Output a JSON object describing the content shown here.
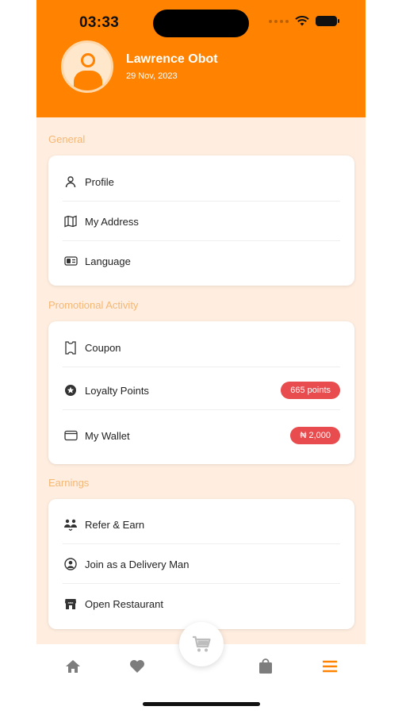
{
  "status": {
    "time": "03:33"
  },
  "profile": {
    "name": "Lawrence Obot",
    "date": "29 Nov, 2023"
  },
  "sections": {
    "general": {
      "title": "General",
      "items": [
        {
          "label": "Profile",
          "icon": "person-icon"
        },
        {
          "label": "My Address",
          "icon": "map-icon"
        },
        {
          "label": "Language",
          "icon": "language-icon"
        }
      ]
    },
    "promotional": {
      "title": "Promotional Activity",
      "items": [
        {
          "label": "Coupon",
          "icon": "coupon-icon"
        },
        {
          "label": "Loyalty Points",
          "icon": "star-badge-icon",
          "badge": "665 points"
        },
        {
          "label": "My Wallet",
          "icon": "wallet-icon",
          "badge": "₦ 2,000"
        }
      ]
    },
    "earnings": {
      "title": "Earnings",
      "items": [
        {
          "label": "Refer & Earn",
          "icon": "people-icon"
        },
        {
          "label": "Join as a Delivery Man",
          "icon": "delivery-man-icon"
        },
        {
          "label": "Open Restaurant",
          "icon": "store-icon"
        }
      ]
    }
  },
  "nav": {
    "items": [
      "home-icon",
      "heart-icon",
      "cart-icon",
      "bag-icon",
      "menu-icon"
    ],
    "active": "menu-icon"
  },
  "colors": {
    "brand": "#ff8200",
    "badge": "#e84c4f",
    "background": "#ffeee0",
    "section_title": "#f5b774"
  }
}
